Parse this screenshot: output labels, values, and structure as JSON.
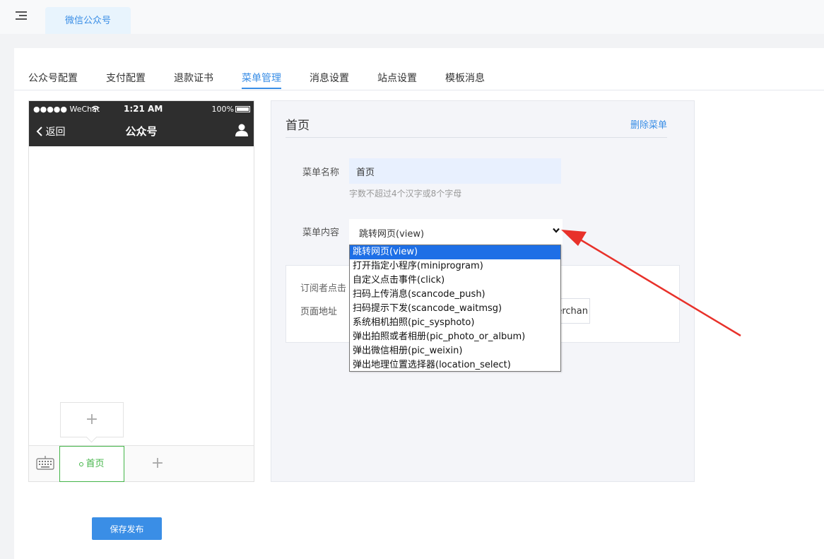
{
  "top_tab": "微信公众号",
  "subtabs": [
    {
      "label": "公众号配置"
    },
    {
      "label": "支付配置"
    },
    {
      "label": "退款证书"
    },
    {
      "label": "菜单管理"
    },
    {
      "label": "消息设置"
    },
    {
      "label": "站点设置"
    },
    {
      "label": "模板消息"
    }
  ],
  "active_subtab": "菜单管理",
  "phone": {
    "status_left": "●●●●● WeChat",
    "time": "1:21 AM",
    "battery": "100%",
    "back": "返回",
    "title": "公众号",
    "add_sub": "+",
    "menu_item": "首页",
    "add_menu": "+"
  },
  "editor": {
    "title": "首页",
    "delete": "删除菜单",
    "name_label": "菜单名称",
    "name_value": "首页",
    "name_hint": "字数不超过4个汉字或8个字母",
    "content_label": "菜单内容",
    "content_value": "跳转网页(view)",
    "subscriber_text": "订阅者点击",
    "page_url_label": "页面地址",
    "page_url_value": "merchan"
  },
  "dropdown_options": [
    "跳转网页(view)",
    "打开指定小程序(miniprogram)",
    "自定义点击事件(click)",
    "扫码上传消息(scancode_push)",
    "扫码提示下发(scancode_waitmsg)",
    "系统相机拍照(pic_sysphoto)",
    "弹出拍照或者相册(pic_photo_or_album)",
    "弹出微信相册(pic_weixin)",
    "弹出地理位置选择器(location_select)"
  ],
  "save_button": "保存发布",
  "colors": {
    "accent": "#3a8ee6",
    "menu_green": "#44b549",
    "arrow_red": "#e8312a",
    "selected_option": "#1e6fe6"
  }
}
